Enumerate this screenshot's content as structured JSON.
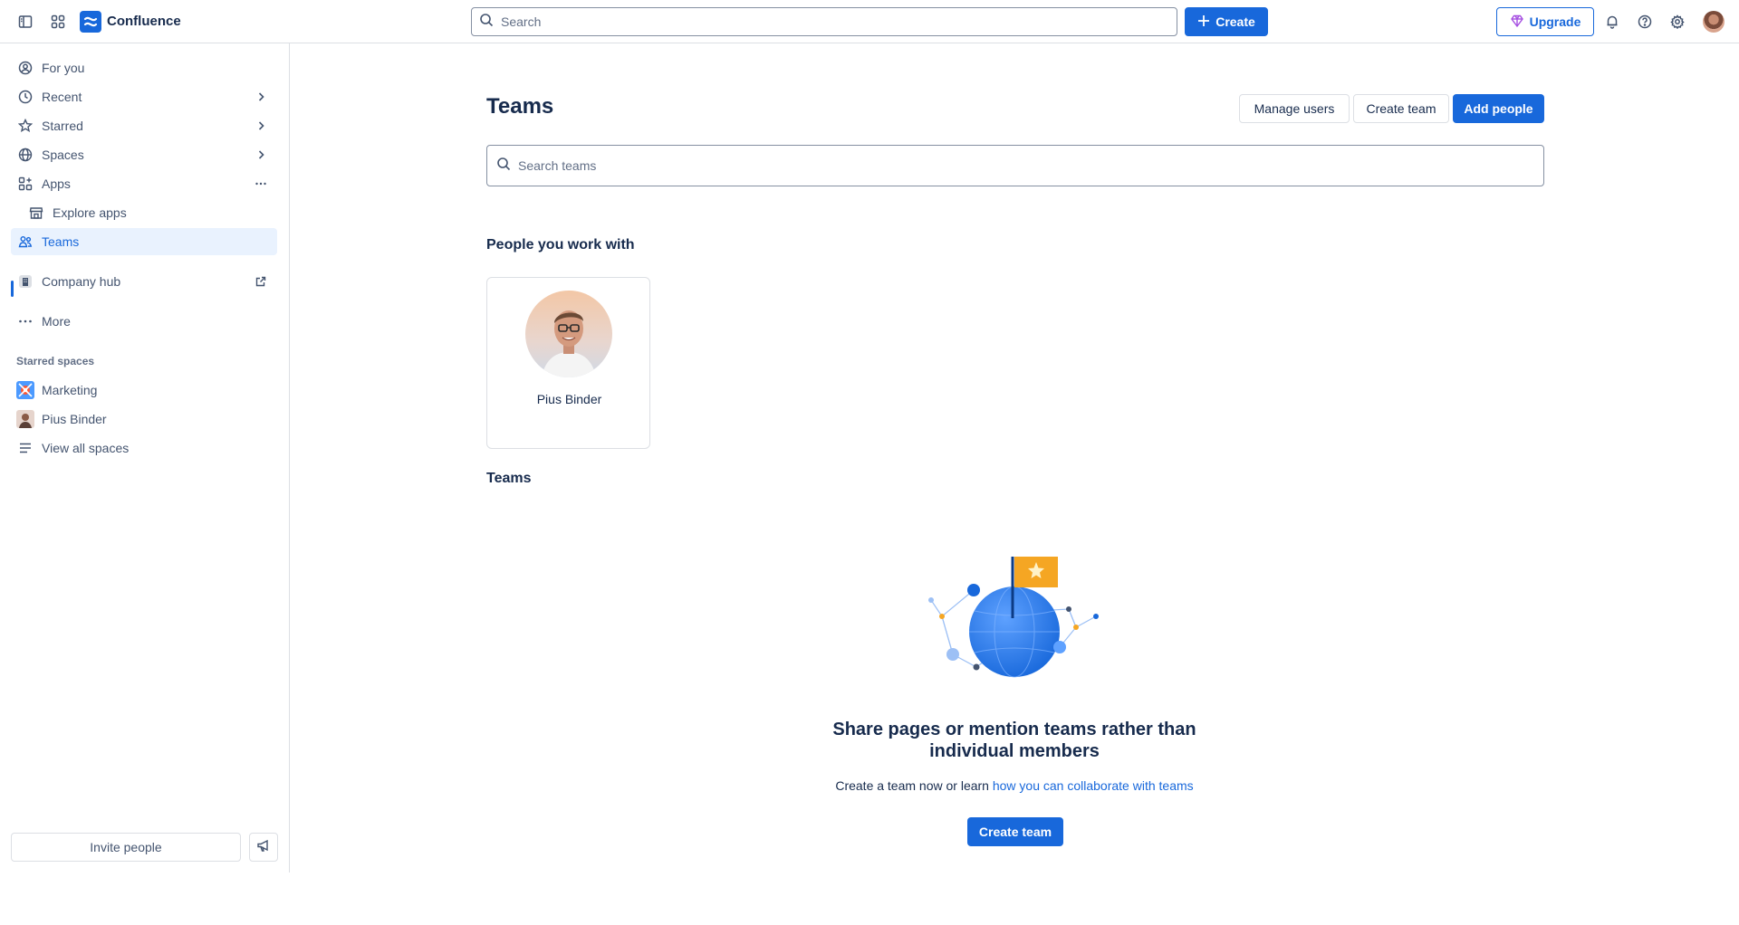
{
  "topbar": {
    "brand": "Confluence",
    "search_placeholder": "Search",
    "create_label": "Create",
    "upgrade_label": "Upgrade"
  },
  "sidebar": {
    "items": [
      {
        "label": "For you",
        "icon": "user-circle-icon"
      },
      {
        "label": "Recent",
        "icon": "clock-icon",
        "trail": "chevron-right-icon"
      },
      {
        "label": "Starred",
        "icon": "star-icon",
        "trail": "chevron-right-icon"
      },
      {
        "label": "Spaces",
        "icon": "globe-icon",
        "trail": "chevron-right-icon"
      },
      {
        "label": "Apps",
        "icon": "apps-icon",
        "trail": "more-icon"
      },
      {
        "label": "Explore apps",
        "icon": "store-icon"
      },
      {
        "label": "Teams",
        "icon": "people-icon",
        "active": true
      },
      {
        "label": "Company hub",
        "icon": "company-hub-icon",
        "trail": "external-link-icon"
      },
      {
        "label": "More",
        "icon": "more-icon"
      }
    ],
    "starred_title": "Starred spaces",
    "starred": [
      {
        "label": "Marketing",
        "icon": "marketing-space-icon"
      },
      {
        "label": "Pius Binder",
        "icon": "personal-space-avatar"
      },
      {
        "label": "View all spaces",
        "icon": "list-icon"
      }
    ],
    "invite_label": "Invite people"
  },
  "main": {
    "title": "Teams",
    "manage_users_label": "Manage users",
    "create_team_label": "Create team",
    "add_people_label": "Add people",
    "search_placeholder": "Search teams",
    "people_heading": "People you work with",
    "people": [
      {
        "name": "Pius Binder"
      }
    ],
    "teams_heading": "Teams",
    "empty_heading": "Share pages or mention teams rather than individual members",
    "empty_text": "Create a team now or learn ",
    "empty_link": "how you can collaborate with teams",
    "empty_create_label": "Create team"
  },
  "colors": {
    "accent": "#1868db",
    "text": "#172b4d",
    "subtle_text": "#44546f",
    "border": "#dcdfe4",
    "active_bg": "#e9f2fe",
    "flag": "#f5a623"
  }
}
